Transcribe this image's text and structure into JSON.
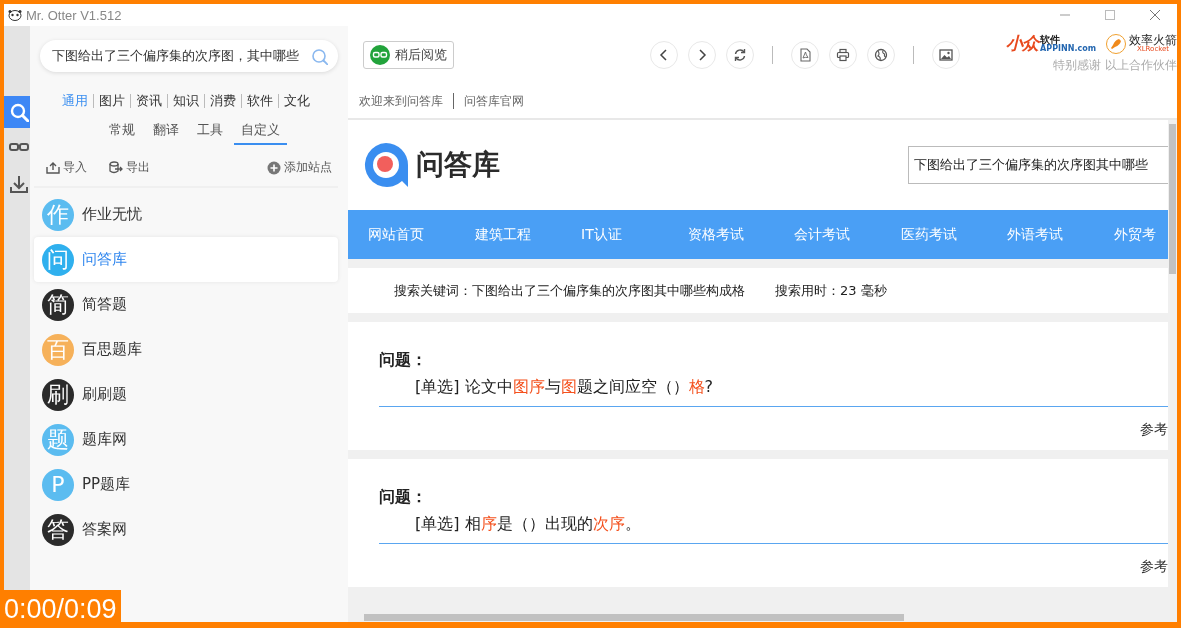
{
  "window": {
    "title": "Mr. Otter V1.512"
  },
  "rail": [
    {
      "kind": "search",
      "selected": true
    },
    {
      "kind": "glasses",
      "selected": false
    },
    {
      "kind": "download",
      "selected": false
    }
  ],
  "sidebar": {
    "search": {
      "value": "下图给出了三个偏序集的次序图，其中哪些"
    },
    "categories": [
      {
        "label": "通用",
        "selected": true
      },
      {
        "label": "图片",
        "selected": false
      },
      {
        "label": "资讯",
        "selected": false
      },
      {
        "label": "知识",
        "selected": false
      },
      {
        "label": "消费",
        "selected": false
      },
      {
        "label": "软件",
        "selected": false
      },
      {
        "label": "文化",
        "selected": false
      }
    ],
    "subtabs": [
      {
        "label": "常规",
        "selected": false
      },
      {
        "label": "翻译",
        "selected": false
      },
      {
        "label": "工具",
        "selected": false
      },
      {
        "label": "自定义",
        "selected": true
      }
    ],
    "actions": [
      {
        "kind": "import",
        "label": "导入"
      },
      {
        "kind": "export",
        "label": "导出"
      },
      {
        "kind": "add",
        "label": "添加站点"
      }
    ],
    "sites": [
      {
        "icon": "作",
        "label": "作业无忧",
        "color": "#5bbcf0",
        "selected": false
      },
      {
        "icon": "问",
        "label": "问答库",
        "color": "#2fb0ee",
        "selected": true
      },
      {
        "icon": "简",
        "label": "简答题",
        "color": "#2b2b2b",
        "selected": false
      },
      {
        "icon": "百",
        "label": "百思题库",
        "color": "#f6b15a",
        "selected": false
      },
      {
        "icon": "刷",
        "label": "刷刷题",
        "color": "#2b2b2b",
        "selected": false
      },
      {
        "icon": "题",
        "label": "题库网",
        "color": "#5bbcf0",
        "selected": false
      },
      {
        "icon": "P",
        "label": "PP题库",
        "color": "#5bbcf0",
        "selected": false
      },
      {
        "icon": "答",
        "label": "答案网",
        "color": "#2b2b2b",
        "selected": false
      }
    ]
  },
  "toolbar": {
    "read_later": "稍后阅览",
    "buttons": [
      {
        "kind": "back"
      },
      {
        "kind": "forward"
      },
      {
        "kind": "refresh"
      },
      {
        "kind": "separator"
      },
      {
        "kind": "pdf"
      },
      {
        "kind": "print"
      },
      {
        "kind": "globe"
      },
      {
        "kind": "separator"
      },
      {
        "kind": "image"
      }
    ]
  },
  "partners": {
    "appinn_mark": "小众",
    "appinn_name": "软件",
    "appinn_url": "APPINN.com",
    "rocket_name": "效率火箭",
    "rocket_sub": "XLRocket",
    "thanks": "特别感谢 以上合作伙伴"
  },
  "breadcrumb": [
    "欢迎来到问答库",
    "问答库官网"
  ],
  "site": {
    "logo": "问答库",
    "search_value": "下图给出了三个偏序集的次序图其中哪些",
    "nav": [
      "网站首页",
      "建筑工程",
      "IT认证",
      "资格考试",
      "会计考试",
      "医药考试",
      "外语考试",
      "外贸考"
    ],
    "search_info": [
      "搜索关键词：下图给出了三个偏序集的次序图其中哪些构成格",
      "搜索用时：23 毫秒"
    ],
    "questions": [
      {
        "label": "问题：",
        "parts": [
          {
            "text": "[单选] 论文中",
            "highlight": false
          },
          {
            "text": "图序",
            "highlight": true
          },
          {
            "text": "与",
            "highlight": false
          },
          {
            "text": "图",
            "highlight": true
          },
          {
            "text": "题之间应空（）",
            "highlight": false
          },
          {
            "text": "格",
            "highlight": true
          },
          {
            "text": "?",
            "highlight": false
          }
        ],
        "answer": "参考"
      },
      {
        "label": "问题：",
        "parts": [
          {
            "text": "[单选] 相",
            "highlight": false
          },
          {
            "text": "序",
            "highlight": true
          },
          {
            "text": "是（）出现的",
            "highlight": false
          },
          {
            "text": "次序",
            "highlight": true
          },
          {
            "text": "。",
            "highlight": false
          }
        ],
        "answer": "参考"
      }
    ]
  },
  "video_overlay": {
    "time": "0:00/0:09"
  }
}
